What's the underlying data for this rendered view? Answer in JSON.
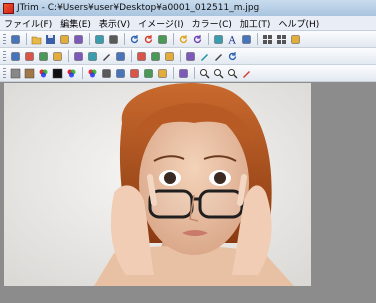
{
  "window": {
    "title": "JTrim - C:¥Users¥user¥Desktop¥a0001_012511_m.jpg"
  },
  "menu": [
    {
      "label": "ファイル(F)"
    },
    {
      "label": "編集(E)"
    },
    {
      "label": "表示(V)"
    },
    {
      "label": "イメージ(I)"
    },
    {
      "label": "カラー(C)"
    },
    {
      "label": "加工(T)"
    },
    {
      "label": "ヘルプ(H)"
    }
  ],
  "toolbar1": [
    "new-file-icon",
    "open-folder-icon",
    "save-icon",
    "print-icon",
    "print-preview-icon",
    "copy-icon",
    "paste-icon",
    "rotate-left-icon",
    "rotate-right-icon",
    "capture-icon",
    "undo-icon",
    "redo-icon",
    "fit-window-icon",
    "text-icon",
    "shape-icon",
    "grid-icon",
    "list-icon",
    "window-mode-icon"
  ],
  "toolbar2": [
    "trim-icon",
    "resize-icon",
    "mirror-icon",
    "flip-icon",
    "brightness-icon",
    "contrast-icon",
    "sharpen-icon",
    "blur-icon",
    "soften-icon",
    "mosaic-icon",
    "frame-icon",
    "edge-icon",
    "pen-icon",
    "eyedrop-icon",
    "spiral-icon"
  ],
  "toolbar3": [
    "grayscale-icon",
    "sepia-icon",
    "rgb-icon",
    "negative-icon",
    "palette-icon",
    "color-balance-icon",
    "gamma-icon",
    "histogram-icon",
    "tone-icon",
    "posterize-icon",
    "noise-icon",
    "emboss-icon",
    "zoom-out-icon",
    "zoom-in-icon",
    "zoom-reset-icon",
    "color-picker-icon"
  ],
  "colors": {
    "accent": "#d02222",
    "canvas": "#8c8c8c"
  }
}
